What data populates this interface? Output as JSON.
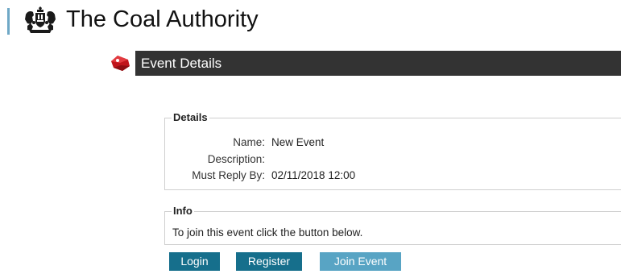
{
  "header": {
    "title": "The Coal Authority",
    "crest_icon": "royal-coat-of-arms-icon",
    "accent_color": "#6fa8c6"
  },
  "page": {
    "heading": "Event Details",
    "heading_icon": "red-tag-icon",
    "heading_bar_color": "#333333"
  },
  "details": {
    "legend": "Details",
    "fields": [
      {
        "label": "Name:",
        "value": "New Event"
      },
      {
        "label": "Description:",
        "value": ""
      },
      {
        "label": "Must Reply By:",
        "value": "02/11/2018 12:00"
      }
    ]
  },
  "info": {
    "legend": "Info",
    "text": "To join this event click the button below."
  },
  "buttons": {
    "login": "Login",
    "register": "Register",
    "join": "Join Event",
    "primary_color": "#166f8c",
    "join_color": "#58a4c4"
  }
}
